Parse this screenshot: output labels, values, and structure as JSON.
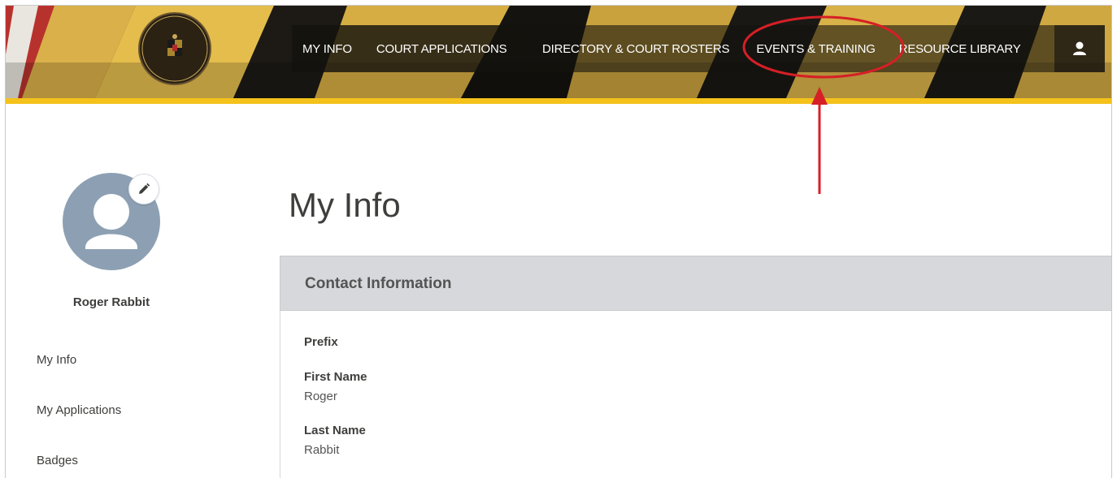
{
  "header": {
    "nav": {
      "my_info": "MY INFO",
      "court_applications": "COURT APPLICATIONS",
      "directory": "DIRECTORY & COURT ROSTERS",
      "events": "EVENTS & TRAINING",
      "resource_library": "RESOURCE LIBRARY"
    },
    "user_icon": "user-icon",
    "logo_icon": "maryland-judiciary-seal"
  },
  "sidebar": {
    "user_name": "Roger Rabbit",
    "links": [
      "My Info",
      "My Applications",
      "Badges"
    ]
  },
  "main": {
    "title": "My Info",
    "section_title": "Contact Information",
    "fields": [
      {
        "label": "Prefix",
        "value": ""
      },
      {
        "label": "First Name",
        "value": "Roger"
      },
      {
        "label": "Last Name",
        "value": "Rabbit"
      }
    ]
  },
  "annotation": {
    "color": "#d61f26",
    "target": "EVENTS & TRAINING"
  },
  "colors": {
    "gold": "#f4c21b",
    "avatar": "#8da0b3",
    "card_header": "#d6d8db"
  }
}
